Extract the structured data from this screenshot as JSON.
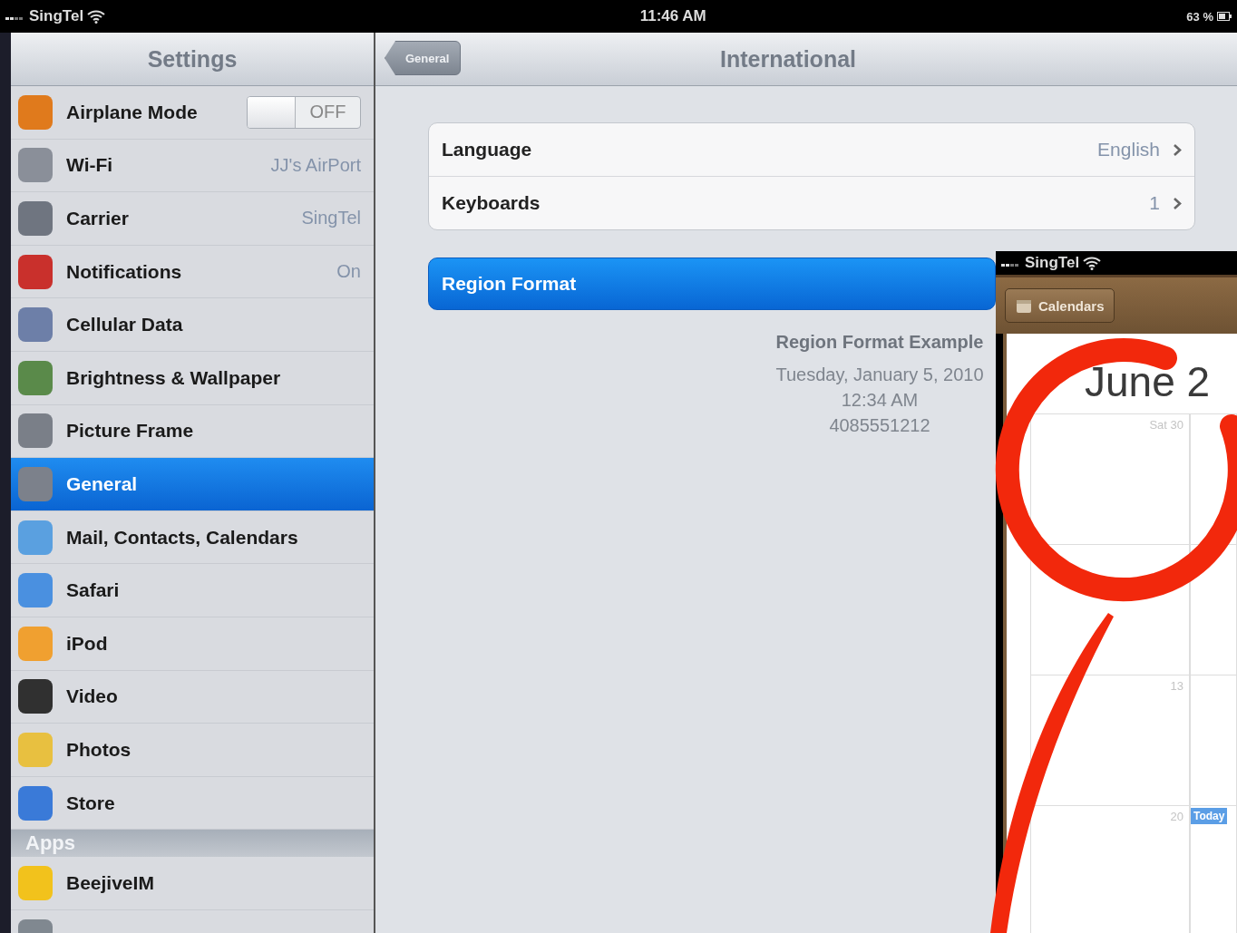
{
  "status_bar": {
    "carrier": "SingTel",
    "time": "11:46 AM",
    "battery": "63 %"
  },
  "sidebar": {
    "title": "Settings",
    "sections": [
      {
        "items": [
          {
            "label": "Airplane Mode",
            "kind": "toggle",
            "on": false,
            "toggle_text": "OFF",
            "color": "#e07a1c",
            "selected": false
          },
          {
            "label": "Wi-Fi",
            "kind": "value",
            "value": "JJ's AirPort",
            "color": "#8a8f99",
            "selected": false
          },
          {
            "label": "Carrier",
            "kind": "value",
            "value": "SingTel",
            "color": "#6f7580",
            "selected": false
          },
          {
            "label": "Notifications",
            "kind": "value",
            "value": "On",
            "color": "#c9302c",
            "selected": false
          },
          {
            "label": "Cellular Data",
            "kind": "plain",
            "color": "#6d7fa8",
            "selected": false
          },
          {
            "label": "Brightness & Wallpaper",
            "kind": "plain",
            "color": "#5a8a4a",
            "selected": false
          },
          {
            "label": "Picture Frame",
            "kind": "plain",
            "color": "#7a7f88",
            "selected": false
          },
          {
            "label": "General",
            "kind": "plain",
            "color": "#7c818b",
            "selected": true
          },
          {
            "label": "Mail, Contacts, Calendars",
            "kind": "plain",
            "color": "#5aa0e0",
            "selected": false
          },
          {
            "label": "Safari",
            "kind": "plain",
            "color": "#4a90e0",
            "selected": false
          },
          {
            "label": "iPod",
            "kind": "plain",
            "color": "#f0a030",
            "selected": false
          },
          {
            "label": "Video",
            "kind": "plain",
            "color": "#303030",
            "selected": false
          },
          {
            "label": "Photos",
            "kind": "plain",
            "color": "#e8c040",
            "selected": false
          },
          {
            "label": "Store",
            "kind": "plain",
            "color": "#3a7ad8",
            "selected": false
          }
        ]
      },
      {
        "header": "Apps",
        "items": [
          {
            "label": "BeejiveIM",
            "kind": "plain",
            "color": "#f2c21c",
            "selected": false
          },
          {
            "kind": "plain",
            "color": "#808890",
            "selected": false
          }
        ]
      }
    ]
  },
  "detail": {
    "back_button": "General",
    "title": "International",
    "group": [
      {
        "label": "Language",
        "value": "English"
      },
      {
        "label": "Keyboards",
        "value": "1"
      }
    ],
    "region_format": {
      "label": "Region Format",
      "selected": true
    },
    "example": {
      "title": "Region Format Example",
      "lines": [
        "Tuesday, January 5, 2010",
        "12:34 AM",
        "4085551212"
      ]
    }
  },
  "overlay": {
    "carrier": "SingTel",
    "back_button": "Calendars",
    "month": "June 2",
    "rows": [
      {
        "day": "Sat 30"
      },
      {
        "day": null
      },
      {
        "day": "13"
      },
      {
        "day": "20",
        "badge": "Today"
      }
    ]
  }
}
